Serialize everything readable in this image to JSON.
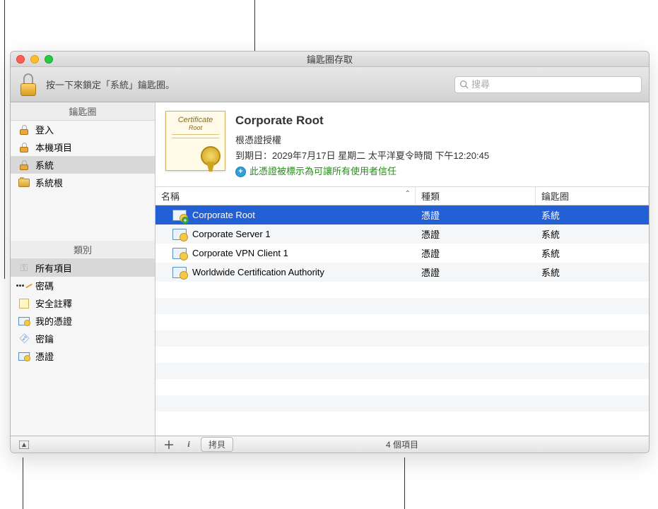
{
  "window": {
    "title": "鑰匙圈存取"
  },
  "toolbar": {
    "lock_hint": "按一下來鎖定「系統」鑰匙圈。",
    "search_placeholder": "搜尋"
  },
  "sidebar": {
    "keychains_header": "鑰匙圈",
    "keychains": [
      {
        "label": "登入",
        "locked": false
      },
      {
        "label": "本機項目",
        "locked": false
      },
      {
        "label": "系統",
        "locked": false,
        "selected": true
      },
      {
        "label": "系統根",
        "type": "folder"
      }
    ],
    "categories_header": "類別",
    "categories": [
      {
        "label": "所有項目",
        "icon": "key",
        "selected": true
      },
      {
        "label": "密碼",
        "icon": "dots"
      },
      {
        "label": "安全註釋",
        "icon": "note"
      },
      {
        "label": "我的憑證",
        "icon": "cert"
      },
      {
        "label": "密鑰",
        "icon": "keyic"
      },
      {
        "label": "憑證",
        "icon": "cert"
      }
    ]
  },
  "detail": {
    "name": "Corporate Root",
    "type_label": "根憑證授權",
    "expiry": "到期日：2029年7月17日 星期二 太平洋夏令時間 下午12:20:45",
    "trust": "此憑證被標示為可讓所有使用者信任",
    "cert_script": "Certificate",
    "cert_sub": "Root"
  },
  "table": {
    "columns": {
      "name": "名稱",
      "kind": "種類",
      "keychain": "鑰匙圈"
    },
    "rows": [
      {
        "name": "Corporate Root",
        "kind": "憑證",
        "keychain": "系統",
        "selected": true,
        "add": true
      },
      {
        "name": "Corporate Server 1",
        "kind": "憑證",
        "keychain": "系統"
      },
      {
        "name": "Corporate VPN Client 1",
        "kind": "憑證",
        "keychain": "系統"
      },
      {
        "name": "Worldwide Certification Authority",
        "kind": "憑證",
        "keychain": "系統"
      }
    ]
  },
  "statusbar": {
    "copy": "拷貝",
    "count": "4 個項目"
  }
}
